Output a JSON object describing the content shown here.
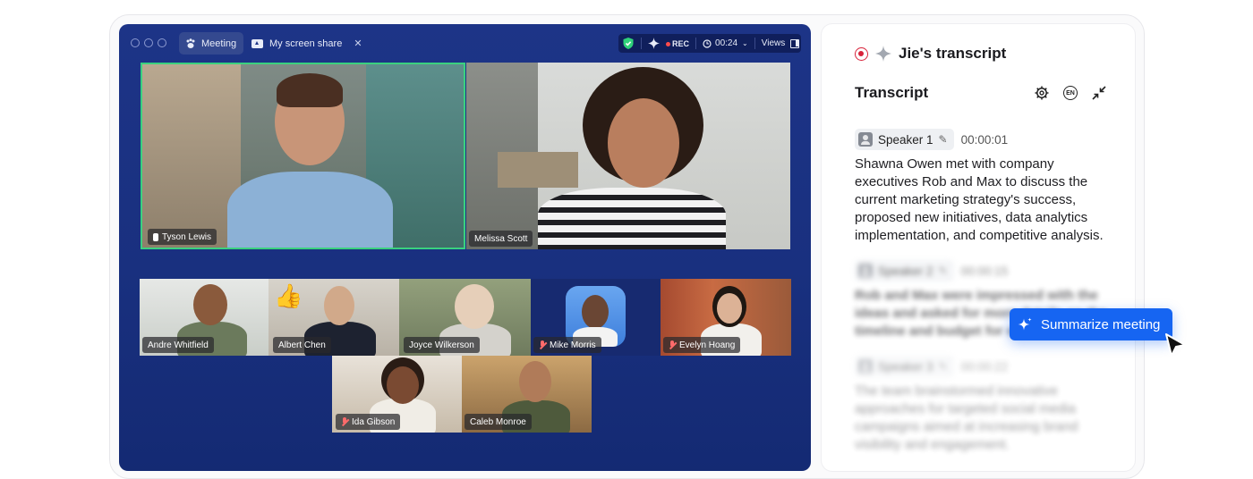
{
  "window": {
    "tabs": [
      {
        "label": "Meeting",
        "icon": "paw-icon"
      },
      {
        "label": "My screen share",
        "icon": "screen-share-icon"
      }
    ],
    "status": {
      "rec_label": "REC",
      "timer": "00:24",
      "views_label": "Views"
    }
  },
  "participants": {
    "main": [
      {
        "name": "Tyson Lewis",
        "pinned": true,
        "active_speaker": true
      },
      {
        "name": "Melissa Scott"
      }
    ],
    "strip": [
      {
        "name": "Andre Whitfield"
      },
      {
        "name": "Albert Chen",
        "reaction": "👍"
      },
      {
        "name": "Joyce Wilkerson"
      },
      {
        "name": "Mike Morris",
        "muted": true
      },
      {
        "name": "Evelyn Hoang",
        "muted": true
      }
    ],
    "bottom": [
      {
        "name": "Ida Gibson",
        "muted": true
      },
      {
        "name": "Caleb Monroe"
      }
    ]
  },
  "transcript_panel": {
    "title": "Jie's transcript",
    "section_title": "Transcript",
    "language": "EN",
    "entries": [
      {
        "speaker": "Speaker 1",
        "time": "00:00:01",
        "text": "Shawna Owen met with company executives Rob and Max to discuss the current marketing strategy's success, proposed new initiatives, data analytics implementation, and competitive analysis."
      },
      {
        "speaker": "Speaker 2",
        "time": "00:00:15",
        "text": "Rob and Max were impressed with the ideas and asked for more details on the timeline and budget for each initiative."
      },
      {
        "speaker": "Speaker 3",
        "time": "00:00:22",
        "text": "The team brainstormed innovative approaches for targeted social media campaigns aimed at increasing brand visibility and engagement."
      }
    ]
  },
  "summarize_button": {
    "label": "Summarize meeting"
  },
  "colors": {
    "meeting_bg": "#1d3487",
    "accent_blue": "#1665f2",
    "active_speaker_border": "#3ad17f",
    "record_red": "#d8223a"
  }
}
